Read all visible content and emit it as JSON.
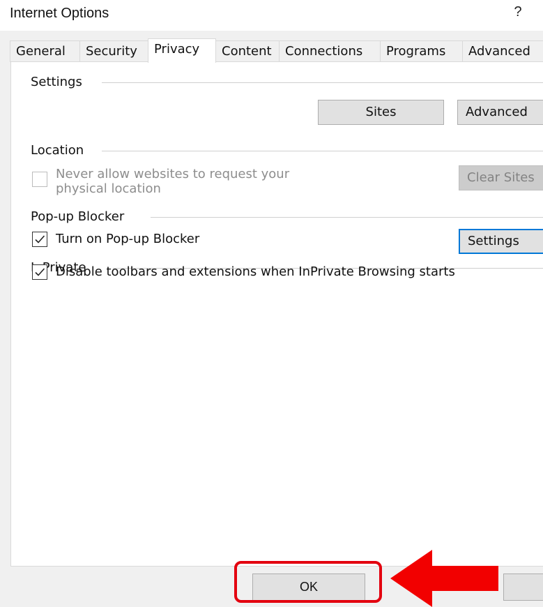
{
  "window": {
    "title": "Internet Options",
    "help_label": "?"
  },
  "tabs": [
    {
      "label": "General",
      "active": false
    },
    {
      "label": "Security",
      "active": false
    },
    {
      "label": "Privacy",
      "active": true
    },
    {
      "label": "Content",
      "active": false
    },
    {
      "label": "Connections",
      "active": false
    },
    {
      "label": "Programs",
      "active": false
    },
    {
      "label": "Advanced",
      "active": false
    }
  ],
  "settings": {
    "heading": "Settings",
    "sites_button": "Sites",
    "advanced_button": "Advanced"
  },
  "location": {
    "heading": "Location",
    "never_allow_line1": "Never allow websites to request your",
    "never_allow_line2": "physical location",
    "never_allow_checked": false,
    "never_allow_enabled": false,
    "clear_sites_button": "Clear Sites"
  },
  "popup_blocker": {
    "heading": "Pop-up Blocker",
    "turn_on_label": "Turn on Pop-up Blocker",
    "turn_on_checked": true,
    "settings_button": "Settings"
  },
  "inprivate": {
    "heading": "InPrivate",
    "disable_toolbars_label": "Disable toolbars and extensions when InPrivate Browsing starts",
    "disable_toolbars_checked": true
  },
  "footer": {
    "ok_button": "OK",
    "cancel_button": ""
  },
  "colors": {
    "annotation_red": "#e3000f",
    "focus_blue": "#0078d7"
  }
}
